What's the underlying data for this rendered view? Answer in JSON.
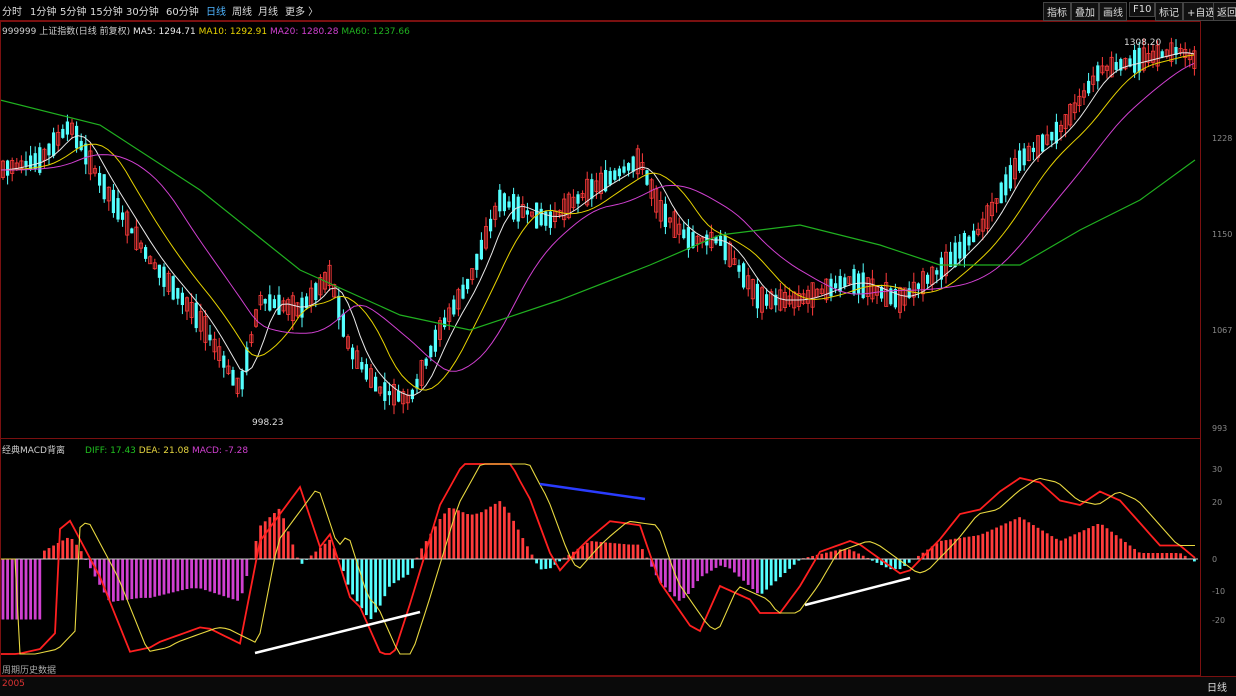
{
  "toolbar": {
    "periods": [
      "分时",
      "1分钟",
      "5分钟",
      "15分钟",
      "30分钟",
      "60分钟",
      "日线",
      "周线",
      "月线",
      "更多 〉"
    ],
    "active_period": "日线",
    "tools": [
      "指标",
      "叠加",
      "画线",
      "F10",
      "标记",
      "+自选",
      "返回"
    ]
  },
  "price_panel": {
    "code": "999999",
    "name": "上证指数(日线 前复权)",
    "ma5": "MA5: 1294.71",
    "ma10": "MA10: 1292.91",
    "ma20": "MA20: 1280.28",
    "ma60": "MA60: 1237.66",
    "high_label": "1308.20",
    "low_label": "998.23",
    "axis_labels": [
      "1228",
      "1150",
      "1067",
      "993"
    ]
  },
  "macd_panel": {
    "title": "经典MACD背离",
    "diff": "DIFF: 17.43",
    "dea": "DEA: 21.08",
    "macd": "MACD: -7.28",
    "axis_labels": [
      "30",
      "20",
      "0",
      "-10",
      "-20"
    ],
    "footer": "周期历史数据"
  },
  "bottom": {
    "year": "2005",
    "right_label": "日线"
  },
  "colors": {
    "up": "#ff3b3b",
    "down": "#54ffff",
    "ma5": "#e8e8e8",
    "ma10": "#e6d200",
    "ma20": "#d040d0",
    "ma60": "#20b020",
    "diff": "#ff2020",
    "dea": "#e8d840",
    "signal_line": "#2a3cff",
    "div_line": "#ffffff"
  },
  "chart_data": {
    "type": "candlestick_macd",
    "price_high": 1308.2,
    "price_low": 998.23,
    "macd_range": [
      -25,
      35
    ]
  }
}
